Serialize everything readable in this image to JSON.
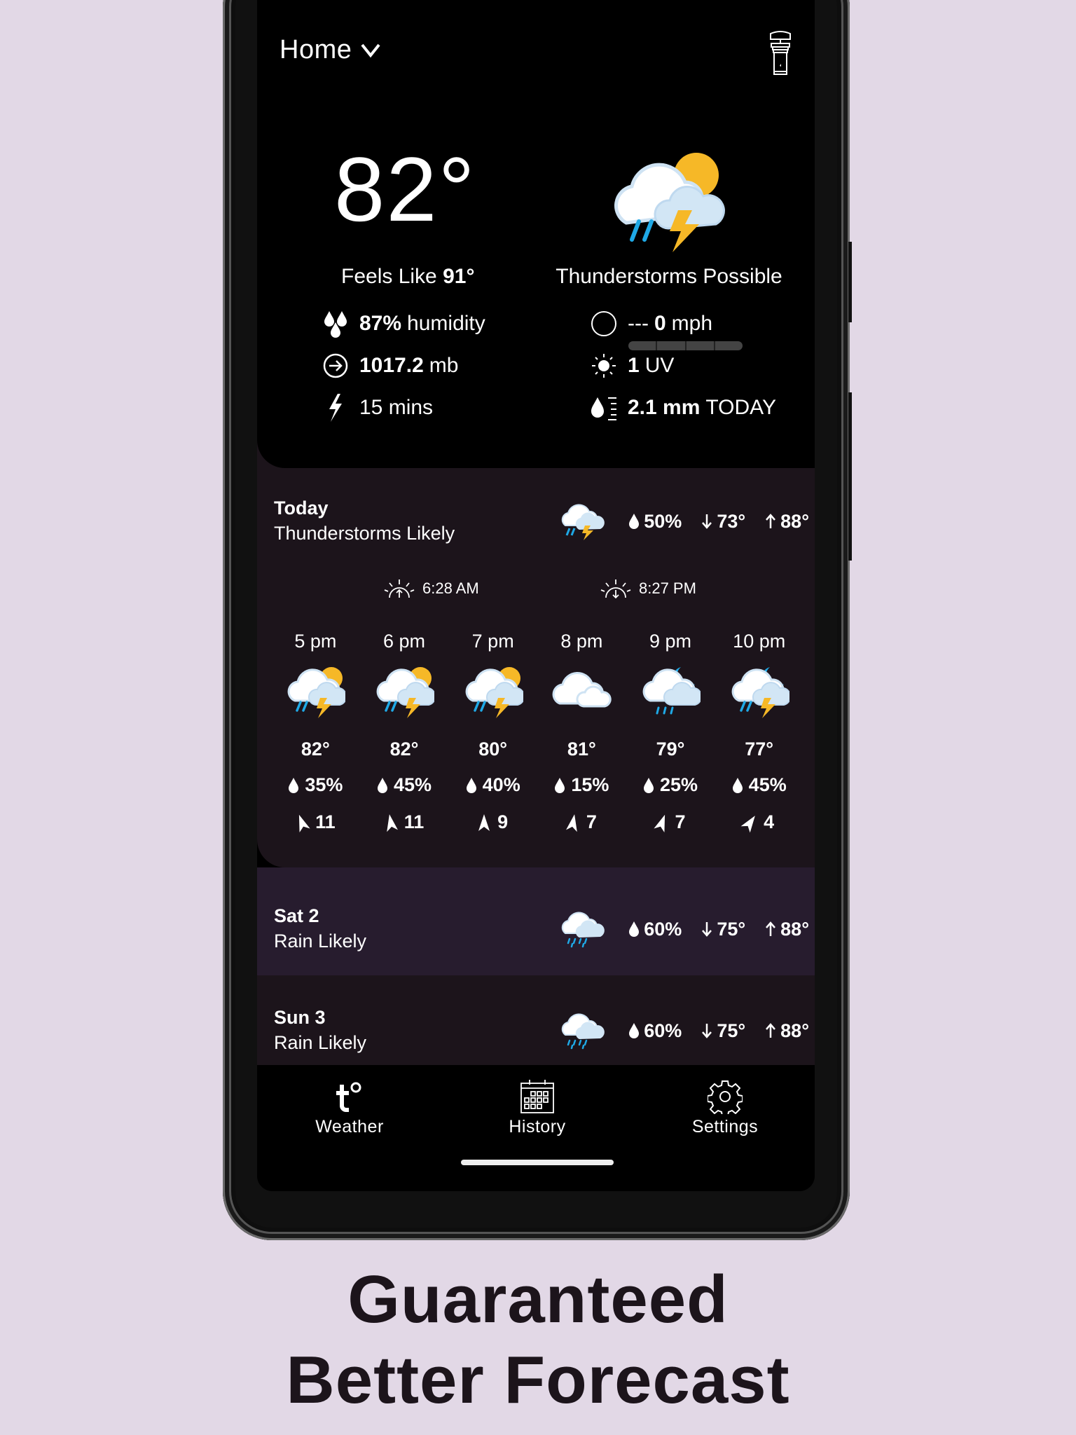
{
  "header": {
    "location": "Home",
    "location_icon": "chevron-down-icon",
    "station_icon": "weather-station-icon"
  },
  "current": {
    "temperature": "82°",
    "feels_like_label": "Feels Like",
    "feels_like_value": "91°",
    "condition": "Thunderstorms Possible",
    "condition_icon": "thunderstorm-partly-sunny-icon",
    "humidity_value": "87%",
    "humidity_unit": "humidity",
    "pressure_value": "1017.2",
    "pressure_unit": "mb",
    "lightning_value": "15 mins",
    "wind_direction": "---",
    "wind_speed": "0",
    "wind_unit": "mph",
    "wind_gauge_fraction": 0,
    "uv_value": "1",
    "uv_unit": "UV",
    "rain_value": "2.1 mm",
    "rain_unit": "TODAY"
  },
  "today": {
    "title": "Today",
    "condition": "Thunderstorms Likely",
    "icon": "thunderstorm-icon",
    "precip": "50%",
    "low": "73°",
    "high": "88°",
    "sunrise": "6:28 AM",
    "sunset": "8:27 PM",
    "hours": [
      {
        "time": "5 pm",
        "icon": "thunderstorm-sun-icon",
        "temp": "82°",
        "precip": "35%",
        "wind": "11",
        "wind_deg": 340
      },
      {
        "time": "6 pm",
        "icon": "thunderstorm-sun-icon",
        "temp": "82°",
        "precip": "45%",
        "wind": "11",
        "wind_deg": 350
      },
      {
        "time": "7 pm",
        "icon": "thunderstorm-sun-icon",
        "temp": "80°",
        "precip": "40%",
        "wind": "9",
        "wind_deg": 0
      },
      {
        "time": "8 pm",
        "icon": "cloudy-icon",
        "temp": "81°",
        "precip": "15%",
        "wind": "7",
        "wind_deg": 10
      },
      {
        "time": "9 pm",
        "icon": "rain-moon-icon",
        "temp": "79°",
        "precip": "25%",
        "wind": "7",
        "wind_deg": 20
      },
      {
        "time": "10 pm",
        "icon": "thunderstorm-moon-icon",
        "temp": "77°",
        "precip": "45%",
        "wind": "4",
        "wind_deg": 35
      }
    ]
  },
  "daily": [
    {
      "title": "Sat 2",
      "condition": "Rain Likely",
      "icon": "rain-icon",
      "precip": "60%",
      "low": "75°",
      "high": "88°"
    },
    {
      "title": "Sun 3",
      "condition": "Rain Likely",
      "icon": "rain-icon",
      "precip": "60%",
      "low": "75°",
      "high": "88°"
    }
  ],
  "nav": {
    "weather": "Weather",
    "history": "History",
    "settings": "Settings"
  },
  "marketing": {
    "line1": "Guaranteed",
    "line2": "Better Forecast"
  },
  "colors": {
    "background": "#e2d8e6",
    "sun": "#f6b827",
    "rain": "#1fa9e6",
    "cloud_back": "#ffffff",
    "cloud_front": "#d2e6f5",
    "card": "#1c141b",
    "row_alt": "#271c2e"
  }
}
